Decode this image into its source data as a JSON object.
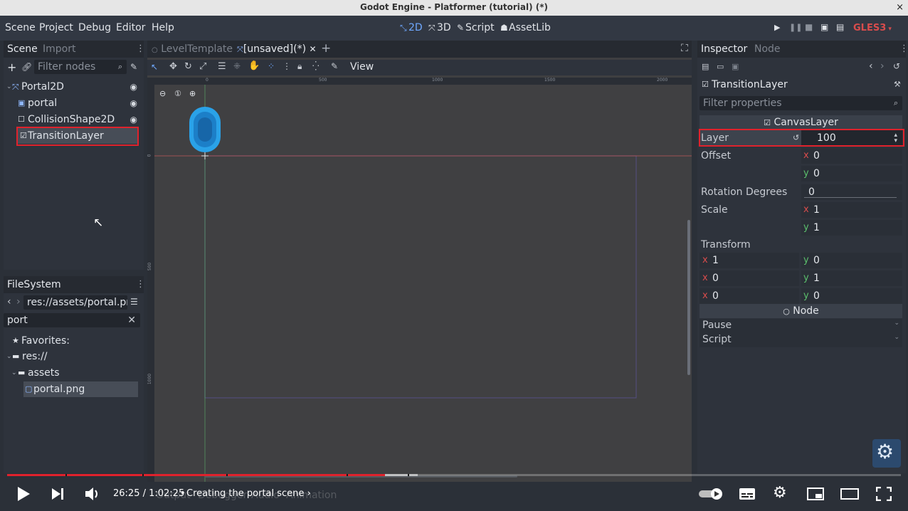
{
  "window": {
    "title": "Godot Engine - Platformer (tutorial) (*)",
    "close": "×"
  },
  "menu": {
    "items": [
      "Scene",
      "Project",
      "Debug",
      "Editor",
      "Help"
    ]
  },
  "workspaces": {
    "2d": "2D",
    "3d": "3D",
    "script": "Script",
    "assetlib": "AssetLib",
    "renderer": "GLES3"
  },
  "scene_dock": {
    "tabs": [
      "Scene",
      "Import"
    ],
    "filter_placeholder": "Filter nodes",
    "tree": [
      {
        "label": "Portal2D"
      },
      {
        "label": "portal"
      },
      {
        "label": "CollisionShape2D"
      },
      {
        "label": "TransitionLayer"
      }
    ]
  },
  "filesystem": {
    "title": "FileSystem",
    "path": "res://assets/portal.pn",
    "search_value": "port",
    "favorites": "Favorites:",
    "root": "res://",
    "folder": "assets",
    "file": "portal.png"
  },
  "editor_tabs": {
    "tab1": "LevelTemplate",
    "tab2": "[unsaved](*)",
    "add": "+"
  },
  "toolbar": {
    "view_label": "View"
  },
  "ruler": {
    "h_ticks": [
      "0",
      "500",
      "1000",
      "1500",
      "2000"
    ],
    "v_ticks": [
      "0",
      "500",
      "1000"
    ]
  },
  "bottom_tabs": [
    "Output",
    "Debugger",
    "Audio",
    "Animation"
  ],
  "inspector": {
    "tabs": [
      "Inspector",
      "Node"
    ],
    "node_name": "TransitionLayer",
    "filter_placeholder": "Filter properties",
    "section_canvaslayer": "CanvasLayer",
    "layer": {
      "label": "Layer",
      "value": "100"
    },
    "offset": {
      "label": "Offset",
      "x": "0",
      "y": "0"
    },
    "rotation": {
      "label": "Rotation Degrees",
      "value": "0"
    },
    "scale": {
      "label": "Scale",
      "x": "1",
      "y": "1"
    },
    "transform": {
      "label": "Transform",
      "rows": [
        [
          "1",
          "0"
        ],
        [
          "0",
          "1"
        ],
        [
          "0",
          "0"
        ]
      ]
    },
    "section_node": "Node",
    "pause": "Pause",
    "script": "Script"
  },
  "video": {
    "time": "26:25 / 1:02:25",
    "separator": "•",
    "chapter": "Creating the portal scene",
    "progress_fraction": 0.423,
    "buffered_fraction": 0.459
  },
  "colors": {
    "accent": "#6fa8ff",
    "highlight_box": "#e0222c",
    "progress": "#e0222c"
  }
}
